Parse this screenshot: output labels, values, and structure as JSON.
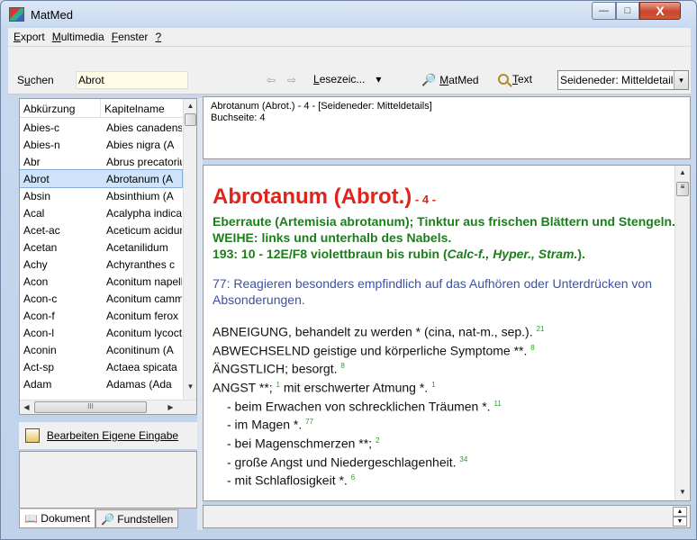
{
  "window": {
    "title": "MatMed",
    "min": "—",
    "max": "□",
    "close": "X"
  },
  "menu": [
    {
      "pre": "",
      "ul": "E",
      "post": "xport"
    },
    {
      "pre": "",
      "ul": "M",
      "post": "ultimedia"
    },
    {
      "pre": "",
      "ul": "F",
      "post": "enster"
    },
    {
      "pre": "",
      "ul": "?",
      "post": ""
    }
  ],
  "toolbar": {
    "search_label_pre": "S",
    "search_label_ul": "u",
    "search_label_post": "chen",
    "search_value": "Abrot",
    "back": "⇦",
    "forward": "⇨",
    "bookmarks_ul": "L",
    "bookmarks_rest": "esezeic...",
    "bookmarks_arrow": "▾",
    "matmed_ul": "M",
    "matmed_rest": "atMed",
    "text_ul": "T",
    "text_rest": "ext",
    "source_select": "Seideneder: Mitteldetails",
    "select_arrow": "▾"
  },
  "list": {
    "col1": "Abkürzung",
    "col2": "Kapitelname",
    "rows": [
      {
        "abbr": "Abies-c",
        "name": "Abies canadensis"
      },
      {
        "abbr": "Abies-n",
        "name": "Abies nigra (A"
      },
      {
        "abbr": "Abr",
        "name": "Abrus precatorius"
      },
      {
        "abbr": "Abrot",
        "name": "Abrotanum (A",
        "selected": true
      },
      {
        "abbr": "Absin",
        "name": "Absinthium (A"
      },
      {
        "abbr": "Acal",
        "name": "Acalypha indica"
      },
      {
        "abbr": "Acet-ac",
        "name": "Aceticum acidum"
      },
      {
        "abbr": "Acetan",
        "name": "Acetanilidum"
      },
      {
        "abbr": "Achy",
        "name": "Achyranthes c"
      },
      {
        "abbr": "Acon",
        "name": "Aconitum napellus"
      },
      {
        "abbr": "Acon-c",
        "name": "Aconitum cammarum"
      },
      {
        "abbr": "Acon-f",
        "name": "Aconitum ferox"
      },
      {
        "abbr": "Acon-l",
        "name": "Aconitum lycoctonum"
      },
      {
        "abbr": "Aconin",
        "name": "Aconitinum (A"
      },
      {
        "abbr": "Act-sp",
        "name": "Actaea spicata"
      },
      {
        "abbr": "Adam",
        "name": "Adamas (Ada"
      }
    ],
    "hscroll_mark": "III"
  },
  "left_bottom": {
    "edit_link": "Bearbeiten Eigene Eingabe",
    "tab_document": "Dokument",
    "tab_locations": "Fundstellen"
  },
  "info": {
    "line1": "Abrotanum (Abrot.) - 4 - [Seideneder: Mitteldetails]",
    "line2": "Buchseite: 4"
  },
  "doc": {
    "title": "Abrotanum (Abrot.)",
    "title_num": " - 4 -",
    "green_lines": [
      "Eberraute (Artemisia abrotanum); Tinktur aus frischen Blättern und Stengeln.",
      "WEIHE: links und unterhalb des Nabels."
    ],
    "green_193_pre": "193: 10 - 12E/F8 violettbraun bis rubin (",
    "green_193_ital": "Calc-f., Hyper., Stram.",
    "green_193_post": ").",
    "blue": "77: Reagieren besonders empfindlich auf das Aufhören oder Unterdrücken von Absonderungen.",
    "symptoms": [
      {
        "text": "ABNEIGUNG, behandelt zu werden * (cina, nat-m., sep.).",
        "ref": "21",
        "indent": false
      },
      {
        "text": "ABWECHSELND geistige und körperliche Symptome **.",
        "ref": "8",
        "indent": false
      },
      {
        "text": "ÄNGSTLICH; besorgt.",
        "ref": "8",
        "indent": false
      },
      {
        "text": "ANGST **;",
        "ref": "1",
        "mid": " mit erschwerter Atmung *.",
        "ref2": "1",
        "indent": false
      },
      {
        "text": "- beim Erwachen von schrecklichen Träumen *.",
        "ref": "11",
        "indent": true
      },
      {
        "text": "- im Magen *.",
        "ref": "77",
        "indent": true
      },
      {
        "text": "- bei Magenschmerzen **;",
        "ref": "2",
        "indent": true
      },
      {
        "text": "- große Angst und Niedergeschlagenheit.",
        "ref": "34",
        "indent": true
      },
      {
        "text": "- mit Schlaflosigkeit *.",
        "ref": "6",
        "indent": true
      }
    ]
  }
}
